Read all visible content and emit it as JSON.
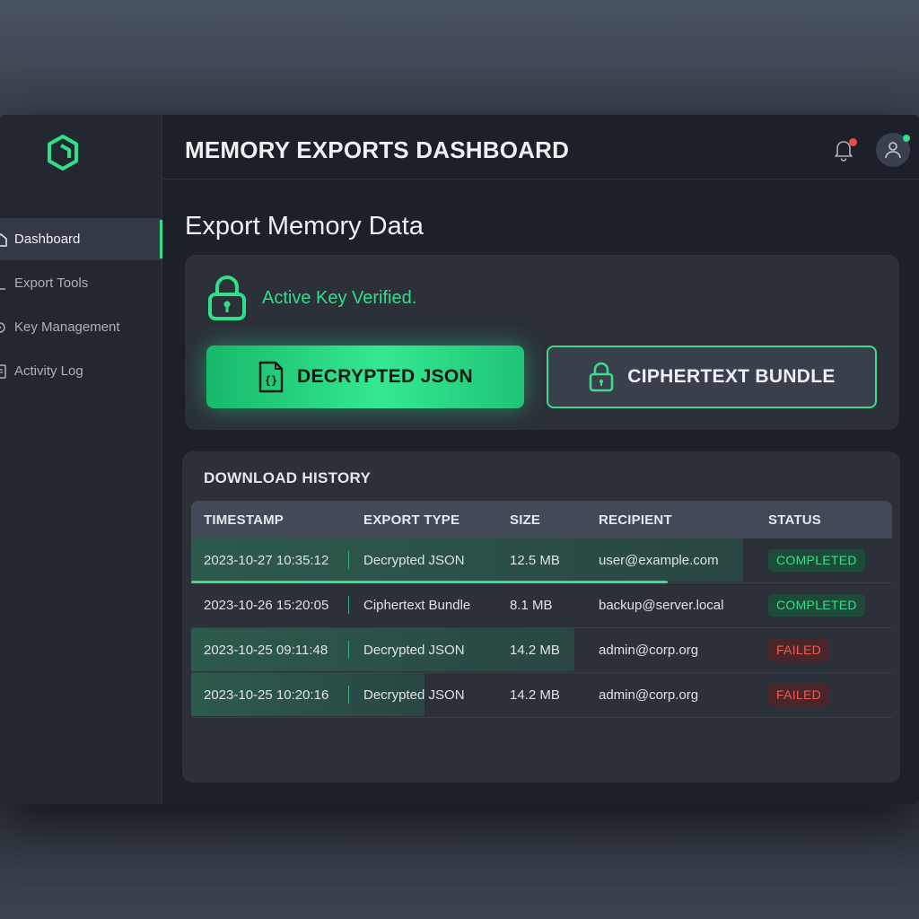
{
  "header": {
    "title": "MEMORY EXPORTS DASHBOARD"
  },
  "sidebar": {
    "items": [
      {
        "label": "Dashboard",
        "icon": "home-icon",
        "active": true
      },
      {
        "label": "Export Tools",
        "icon": "export-icon",
        "active": false
      },
      {
        "label": "Key Management",
        "icon": "key-icon",
        "active": false
      },
      {
        "label": "Activity Log",
        "icon": "document-icon",
        "active": false
      }
    ]
  },
  "main": {
    "title": "Export Memory Data",
    "key_status": "Active Key Verified.",
    "buttons": {
      "decrypted": "DECRYPTED JSON",
      "ciphertext": "CIPHERTEXT BUNDLE"
    }
  },
  "history": {
    "title": "DOWNLOAD HISTORY",
    "columns": [
      "TIMESTAMP",
      "EXPORT TYPE",
      "SIZE",
      "RECIPIENT",
      "STATUS"
    ],
    "rows": [
      {
        "timestamp": "2023-10-27 10:35:12",
        "type": "Decrypted JSON",
        "size": "12.5 MB",
        "recipient": "user@example.com",
        "status": "COMPLETED",
        "state": "ok",
        "progress": 0.68
      },
      {
        "timestamp": "2023-10-26 15:20:05",
        "type": "Ciphertext Bundle",
        "size": "8.1 MB",
        "recipient": "backup@server.local",
        "status": "COMPLETED",
        "state": "ok"
      },
      {
        "timestamp": "2023-10-25 09:11:48",
        "type": "Decrypted JSON",
        "size": "14.2 MB",
        "recipient": "admin@corp.org",
        "status": "FAILED",
        "state": "fail"
      },
      {
        "timestamp": "2023-10-25 10:20:16",
        "type": "Decrypted JSON",
        "size": "14.2 MB",
        "recipient": "admin@corp.org",
        "status": "FAILED",
        "state": "fail"
      }
    ]
  },
  "colors": {
    "accent": "#2ee08a",
    "success": "#3ddc8d",
    "danger": "#ef5b5b",
    "notification": "#f04a4a"
  }
}
